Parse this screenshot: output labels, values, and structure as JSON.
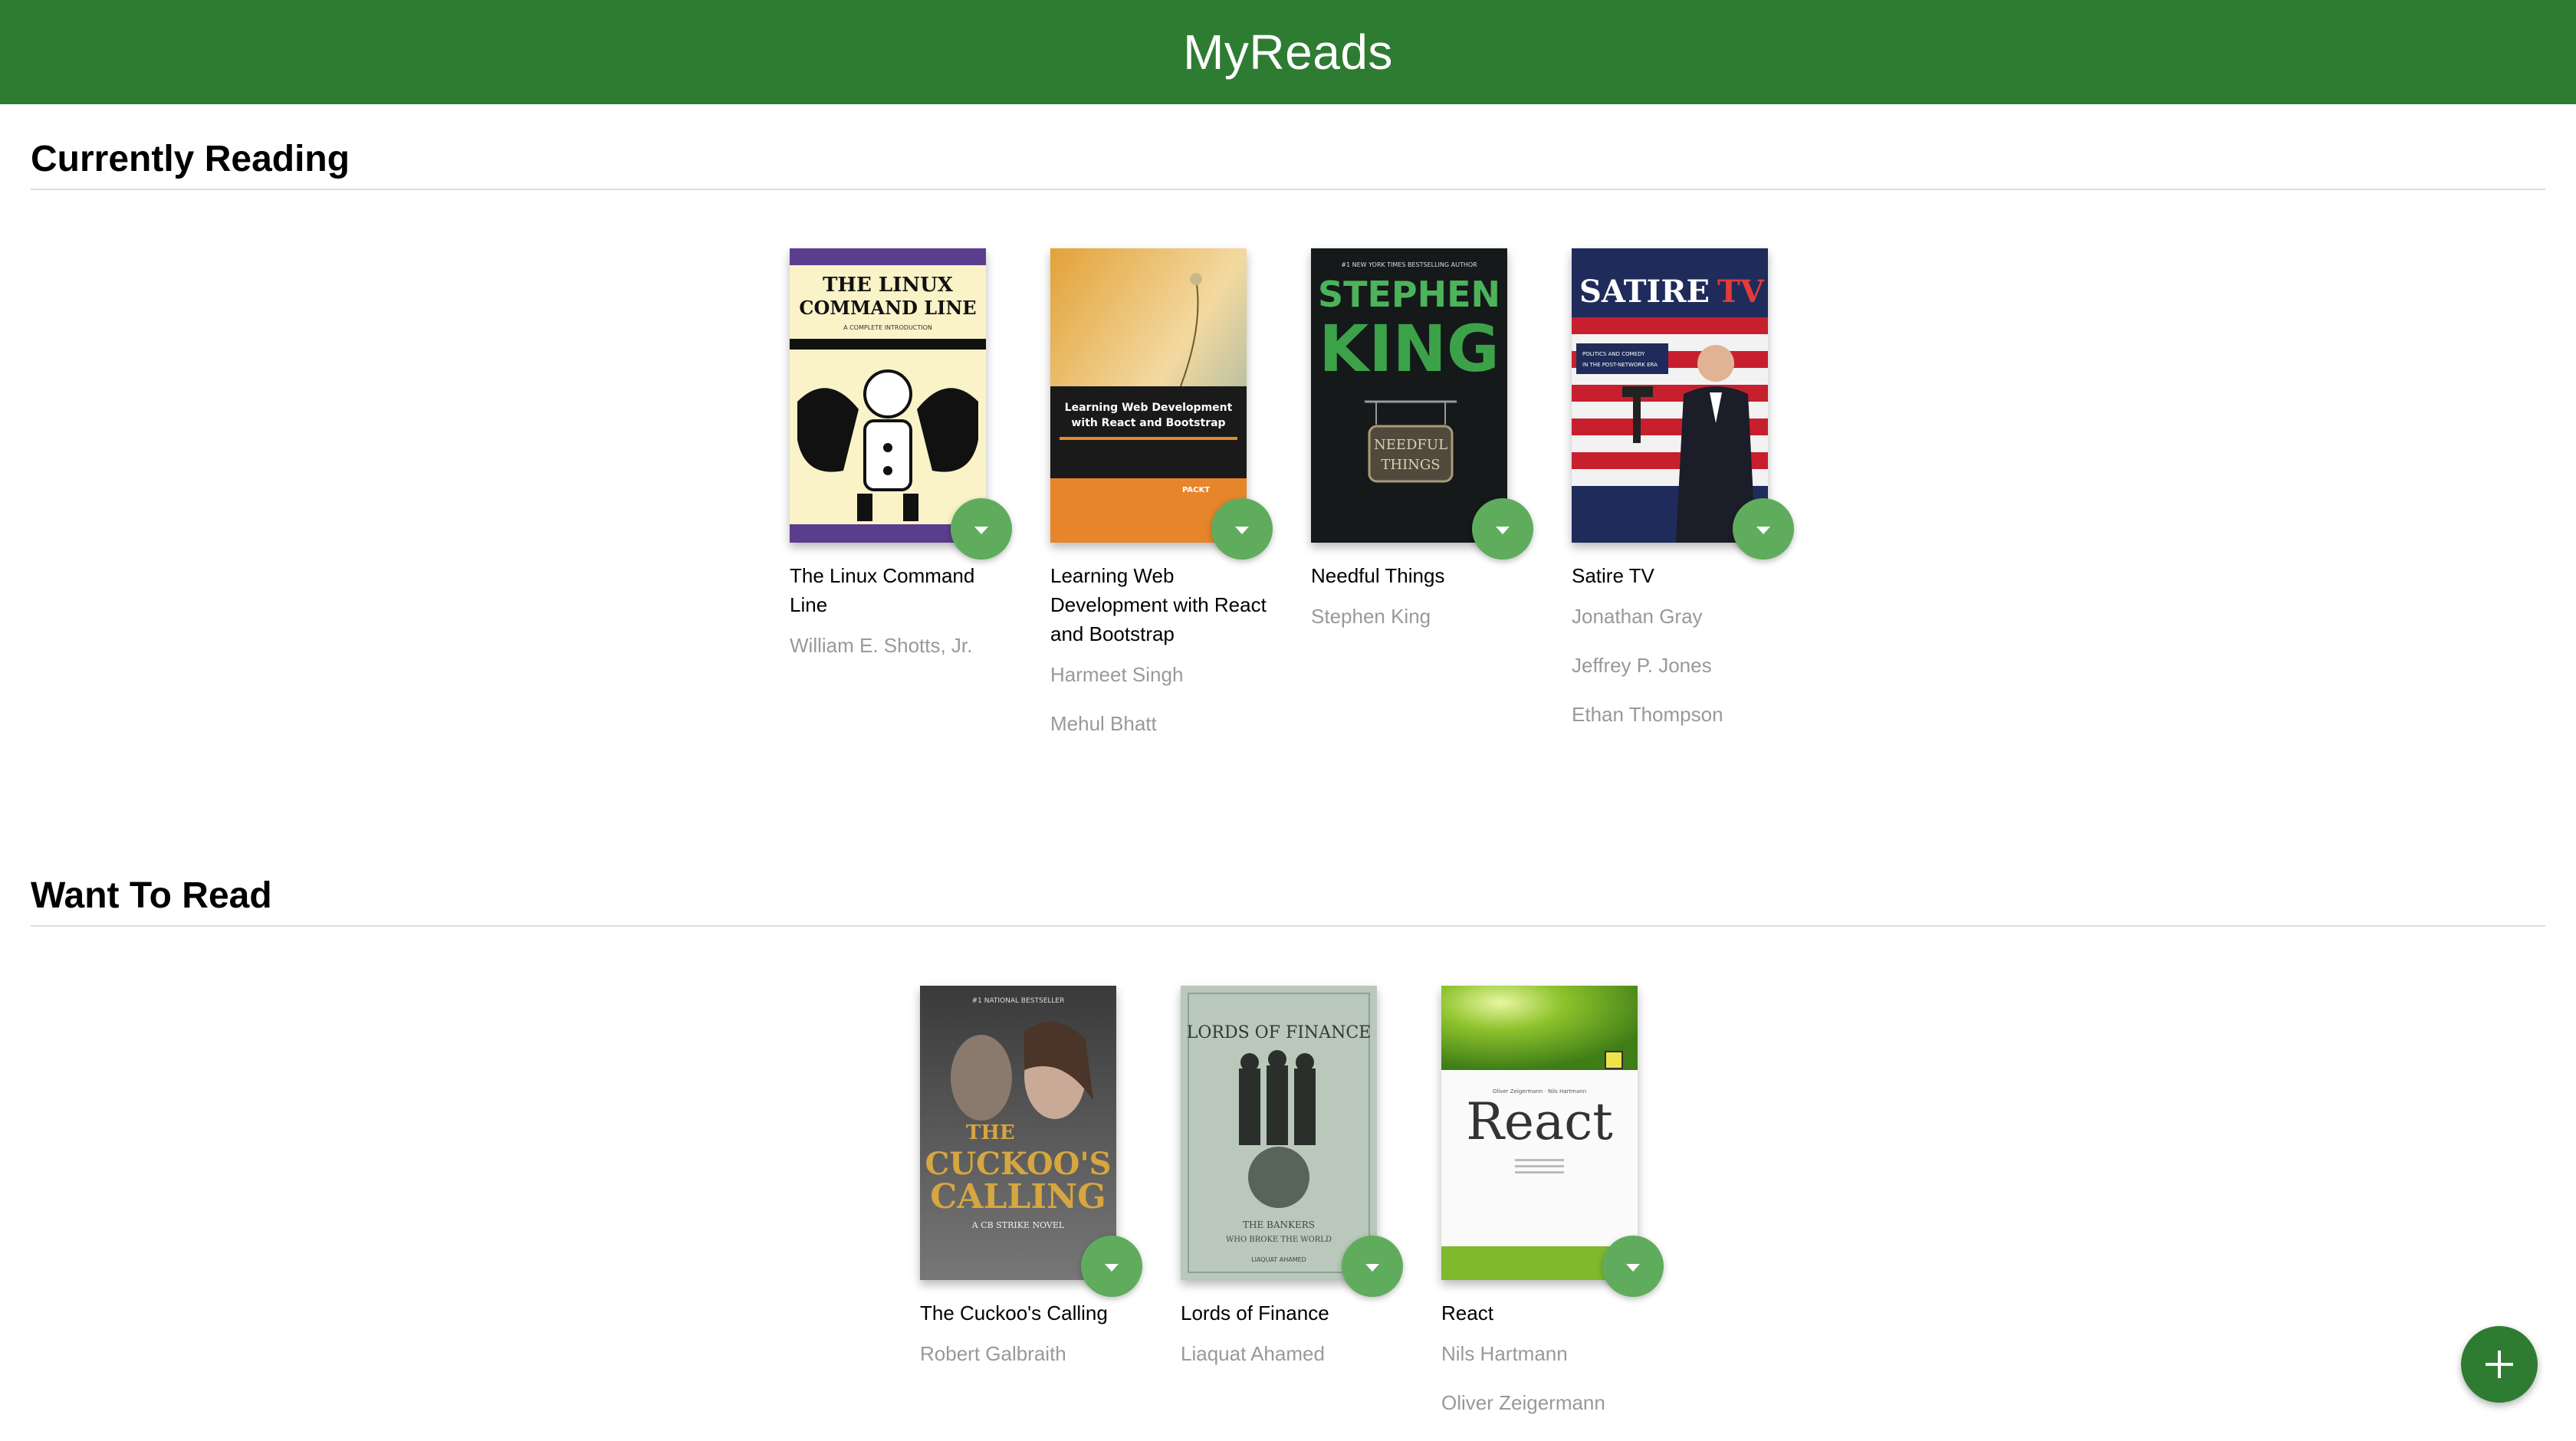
{
  "app": {
    "title": "MyReads"
  },
  "shelves": [
    {
      "title": "Currently Reading",
      "books": [
        {
          "title": "The Linux Command Line",
          "authors": [
            "William E. Shotts, Jr."
          ],
          "cover": {
            "headline": [
              "THE LINUX",
              "COMMAND LINE"
            ],
            "sub": "A COMPLETE INTRODUCTION"
          }
        },
        {
          "title": "Learning Web Development with React and Bootstrap",
          "authors": [
            "Harmeet Singh",
            "Mehul Bhatt"
          ],
          "cover": {
            "headline": [
              "Learning Web Development",
              "with React and Bootstrap"
            ],
            "publisher": "PACKT"
          }
        },
        {
          "title": "Needful Things",
          "authors": [
            "Stephen King"
          ],
          "cover": {
            "tagline": "#1 NEW YORK TIMES BESTSELLING AUTHOR",
            "headline": [
              "STEPHEN",
              "KING"
            ],
            "sign": [
              "NEEDFUL",
              "THINGS"
            ]
          }
        },
        {
          "title": "Satire TV",
          "authors": [
            "Jonathan Gray",
            "Jeffrey P. Jones",
            "Ethan Thompson"
          ],
          "cover": {
            "headline": [
              "SATIRE",
              "TV"
            ],
            "sub": [
              "POLITICS AND COMEDY",
              "IN THE POST-NETWORK ERA"
            ]
          }
        }
      ]
    },
    {
      "title": "Want To Read",
      "books": [
        {
          "title": "The Cuckoo's Calling",
          "authors": [
            "Robert Galbraith"
          ],
          "cover": {
            "tagline": "#1 NATIONAL BESTSELLER",
            "headline": [
              "THE",
              "CUCKOO'S",
              "CALLING"
            ],
            "sub": "A CB STRIKE NOVEL"
          }
        },
        {
          "title": "Lords of Finance",
          "authors": [
            "Liaquat Ahamed"
          ],
          "cover": {
            "headline": [
              "LORDS OF FINANCE"
            ],
            "sub": [
              "THE BANKERS",
              "WHO BROKE THE WORLD"
            ],
            "byline": "LIAQUAT AHAMED"
          }
        },
        {
          "title": "React",
          "authors": [
            "Nils Hartmann",
            "Oliver Zeigermann"
          ],
          "cover": {
            "byline": "Oliver Zeigermann · Nils Hartmann",
            "headline": [
              "React"
            ]
          }
        }
      ]
    }
  ],
  "colors": {
    "header": "#2e7c31",
    "shelf_changer": "#60ac5d",
    "author_text": "#999999"
  },
  "icons": {
    "shelf_changer": "caret-down-icon",
    "add_book": "plus-icon"
  }
}
